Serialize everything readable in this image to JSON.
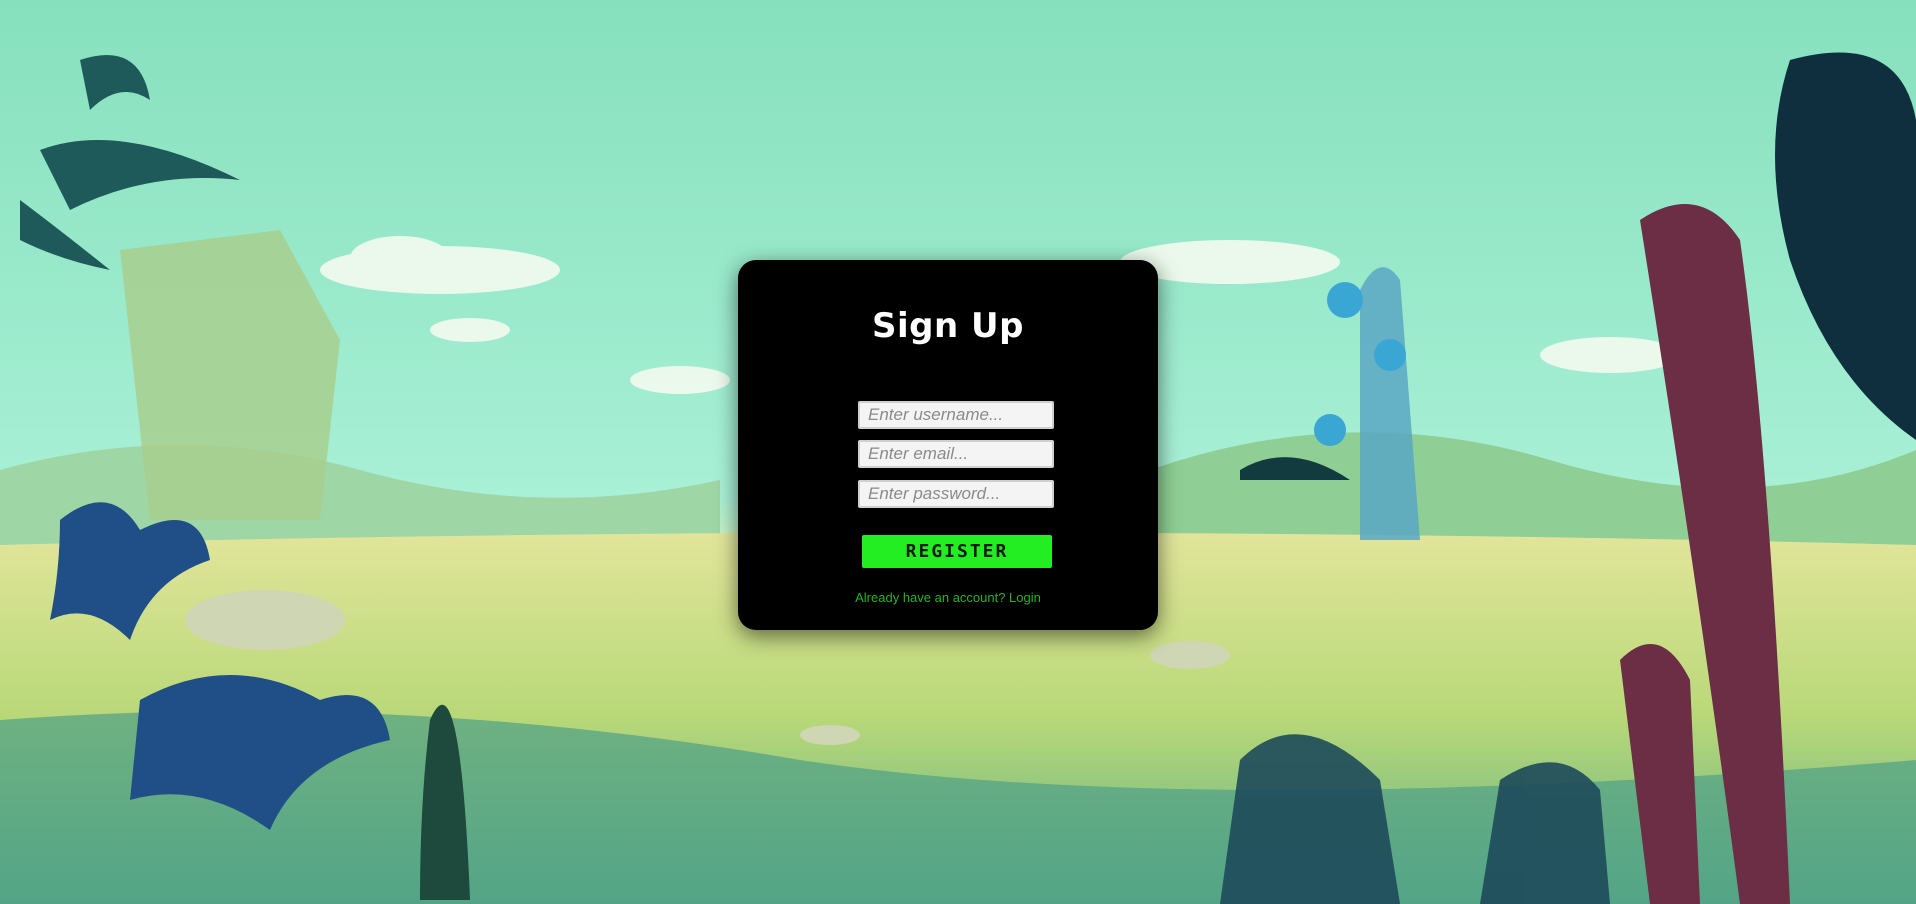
{
  "form": {
    "title": "Sign Up",
    "username_placeholder": "Enter username...",
    "email_placeholder": "Enter email...",
    "password_placeholder": "Enter password...",
    "register_label": "REGISTER",
    "login_link": "Already have an account? Login"
  },
  "colors": {
    "card_background": "#000000",
    "accent": "#22ee22",
    "link": "#24b324",
    "sky": "#8fe3c4"
  },
  "background": {
    "icon": "prehistoric-jungle-landscape"
  }
}
